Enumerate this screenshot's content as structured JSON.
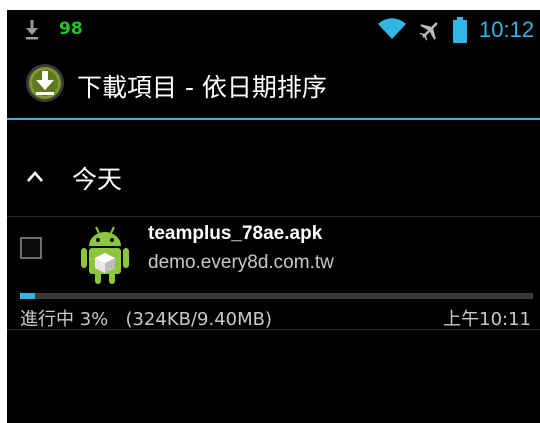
{
  "status_bar": {
    "battery_level": "98",
    "time": "10:12",
    "icons": [
      "download-icon",
      "wifi-icon",
      "airplane-mode-icon",
      "battery-icon"
    ]
  },
  "action_bar": {
    "title": "下載項目 - 依日期排序",
    "icon": "download-app-icon"
  },
  "section": {
    "title": "今天",
    "icon": "chevron-up-icon"
  },
  "downloads": [
    {
      "filename": "teamplus_78ae.apk",
      "source": "demo.every8d.com.tw",
      "progress_percent": 3,
      "status": "進行中 3%",
      "size": "(324KB/9.40MB)",
      "time": "上午10:11",
      "checked": false,
      "icon": "android-package-icon"
    }
  ],
  "colors": {
    "accent": "#33b5e5",
    "battery_text": "#1ec81e",
    "background": "#000000"
  }
}
